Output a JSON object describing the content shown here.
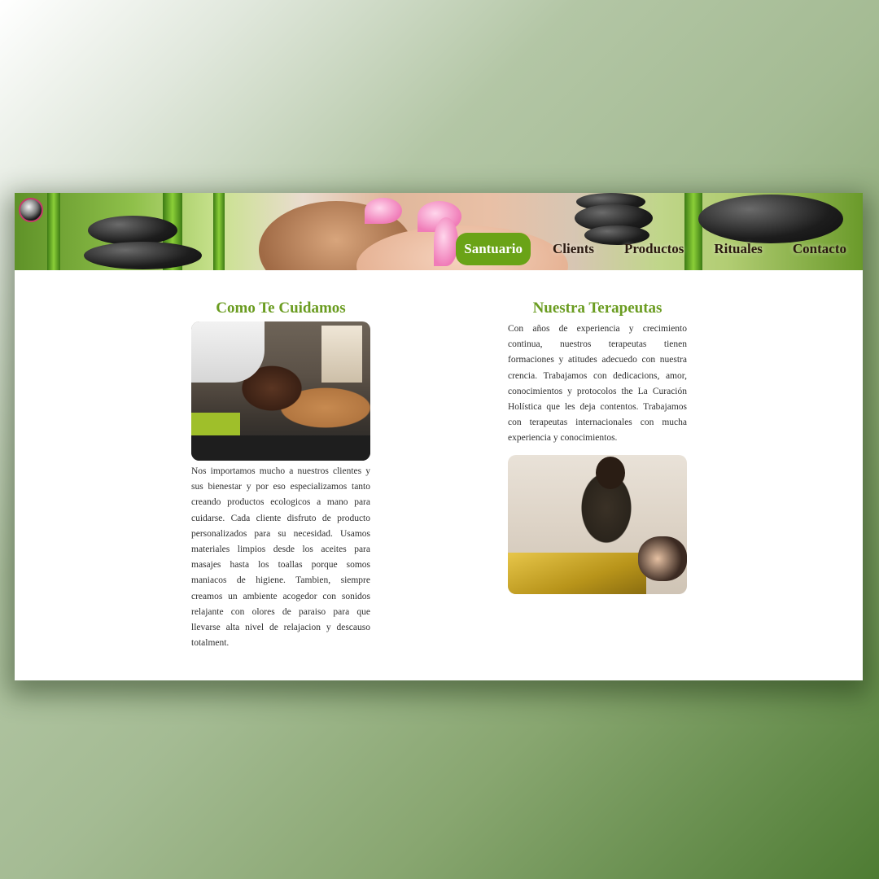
{
  "nav": {
    "items": [
      {
        "label": "Santuario",
        "active": true
      },
      {
        "label": "Clients",
        "active": false
      },
      {
        "label": "Productos",
        "active": false
      },
      {
        "label": "Rituales",
        "active": false
      },
      {
        "label": "Contacto",
        "active": false
      }
    ]
  },
  "left": {
    "title": "Como Te Cuidamos",
    "body": "Nos importamos mucho a nuestros clientes y sus bienestar y por eso especializamos tanto creando productos ecologicos a mano para cuidarse. Cada cliente disfruto de producto personalizados para su necesidad. Usamos materiales limpios desde los aceites para masajes hasta los toallas porque somos maniacos de higiene. Tambien, siempre creamos un ambiente acogedor con sonidos relajante con olores de paraiso para que llevarse alta nivel de relajacion y descauso totalment."
  },
  "right": {
    "title": "Nuestra Terapeutas",
    "body": "Con años de experiencia y crecimiento continua, nuestros terapeutas tienen formaciones y atitudes adecuedo con nuestra crencia. Trabajamos con dedicacions, amor, conocimientos y protocolos the La Curación Holística que les deja contentos. Trabajamos con terapeutas internacionales con mucha experiencia y conocimientos."
  },
  "colors": {
    "accent": "#6aa317",
    "heading": "#6a9c20",
    "nav_text": "#2b1a10"
  }
}
